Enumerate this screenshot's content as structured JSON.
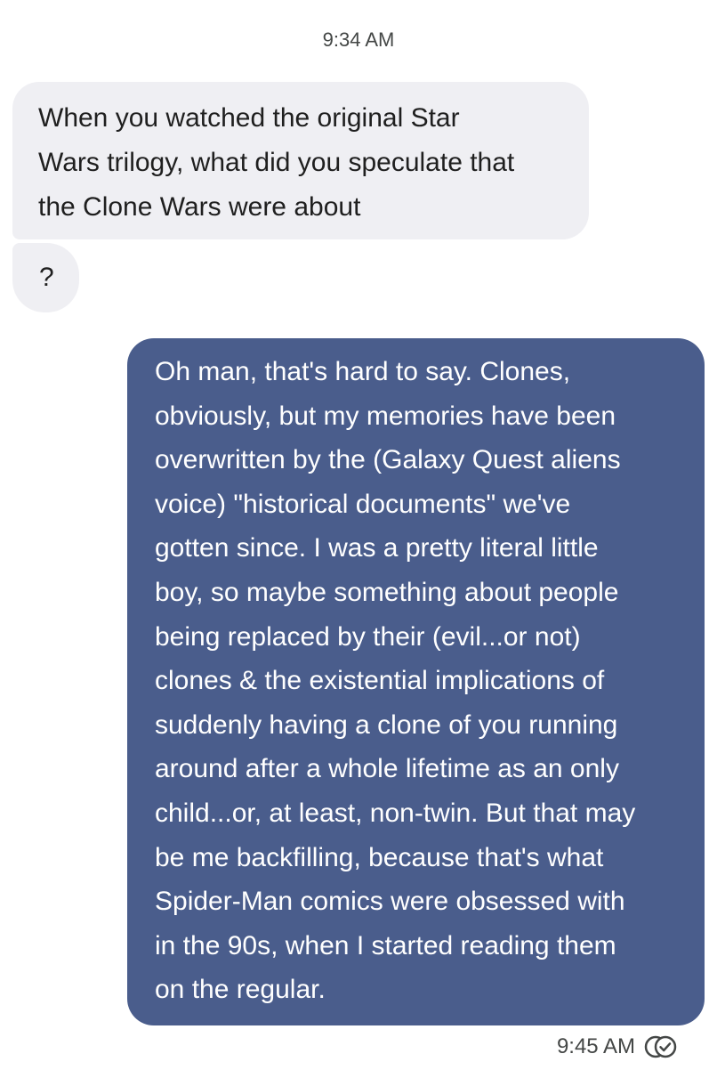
{
  "conversation": {
    "top_timestamp": "9:34 AM",
    "incoming": [
      {
        "text": "When you watched the original Star\nWars trilogy, what did you speculate that\nthe Clone Wars were about"
      },
      {
        "text": "?"
      }
    ],
    "outgoing": {
      "text": "Oh man, that's hard to say. Clones,\nobviously, but my memories have been\noverwritten by the (Galaxy Quest aliens\nvoice) \"historical documents\" we've\ngotten since. I was a pretty literal little\nboy, so maybe something about people\nbeing replaced by their (evil...or not)\nclones & the existential implications of\nsuddenly having a clone of you running\naround after a whole lifetime as an only\nchild...or, at least, non-twin. But that may\nbe me backfilling, because that's what\nSpider-Man comics were obsessed with\nin the 90s, when I started reading them\non the regular.",
      "timestamp": "9:45 AM",
      "status_icon": "read-receipt-icon"
    }
  }
}
